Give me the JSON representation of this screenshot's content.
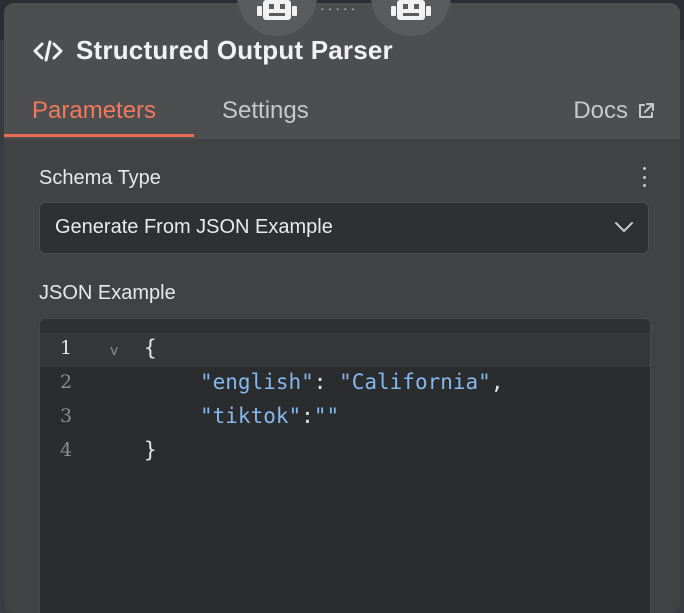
{
  "header": {
    "title": "Structured Output Parser",
    "tabs": [
      {
        "label": "Parameters",
        "active": true
      },
      {
        "label": "Settings",
        "active": false
      }
    ],
    "docs_label": "Docs",
    "node_connector": "·····"
  },
  "schema_type": {
    "label": "Schema Type",
    "selected": "Generate From JSON Example"
  },
  "json_example": {
    "label": "JSON Example",
    "lines": [
      {
        "number": "1",
        "text": "{"
      },
      {
        "number": "2",
        "key": "\"english\"",
        "sep": ": ",
        "value": "\"California\"",
        "trail": ","
      },
      {
        "number": "3",
        "key": "\"tiktok\"",
        "sep": ":",
        "value": "\"\"",
        "trail": ""
      },
      {
        "number": "4",
        "text": "}"
      }
    ],
    "fold_marker": "v"
  },
  "colors": {
    "accent": "#ea6c52",
    "string": "#85b8ee",
    "panel": "#414244",
    "header": "#4d4e50",
    "editor": "#2b2c2d"
  },
  "icons": [
    "code-icon",
    "robot-icon",
    "external-link-icon",
    "chevron-down-icon",
    "more-vertical-icon"
  ]
}
